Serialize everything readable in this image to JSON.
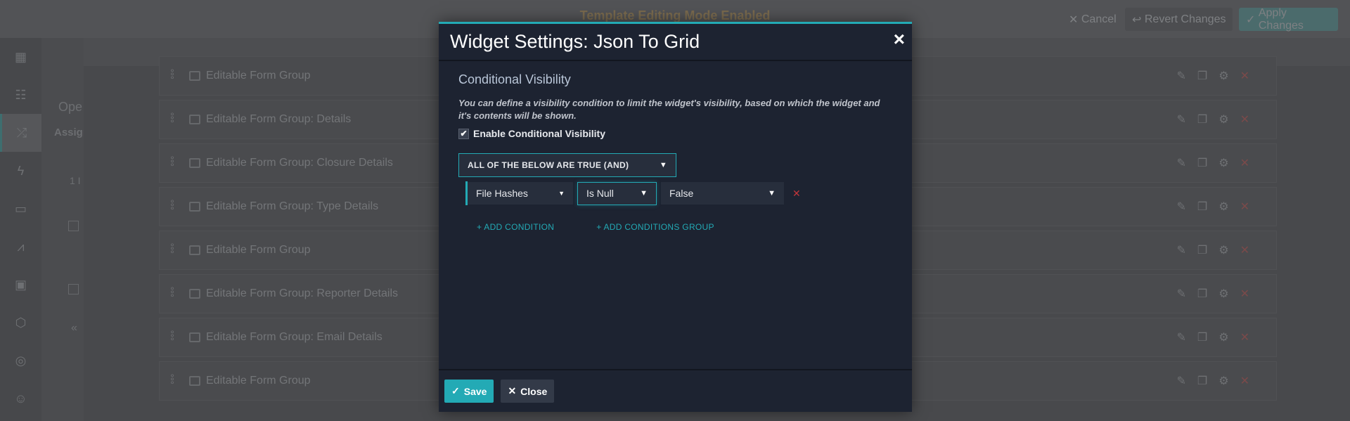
{
  "topbar": {
    "mode_text": "Template Editing Mode Enabled",
    "cancel": "Cancel",
    "revert": "Revert Changes",
    "apply": "Apply Changes"
  },
  "panel": {
    "title_partial": "Ope",
    "subtitle_partial": "Assign",
    "count_partial": "1 I"
  },
  "rows": [
    {
      "label": "Editable Form Group"
    },
    {
      "label": "Editable Form Group: Details"
    },
    {
      "label": "Editable Form Group: Closure Details"
    },
    {
      "label": "Editable Form Group: Type Details"
    },
    {
      "label": "Editable Form Group"
    },
    {
      "label": "Editable Form Group: Reporter Details"
    },
    {
      "label": "Editable Form Group: Email Details"
    },
    {
      "label": "Editable Form Group"
    }
  ],
  "modal": {
    "title": "Widget Settings: Json To Grid",
    "close_icon": "×",
    "section": "Conditional Visibility",
    "description": "You can define a visibility condition to limit the widget's visibility, based on which the widget and it's contents will be shown.",
    "enable_label": "Enable Conditional Visibility",
    "enable_checked": true,
    "group_operator": "ALL OF THE BELOW ARE TRUE (AND)",
    "condition": {
      "field": "File Hashes",
      "operator": "Is Null",
      "value": "False"
    },
    "add_condition": "+ ADD CONDITION",
    "add_group": "+ ADD CONDITIONS GROUP",
    "save": "Save",
    "close": "Close"
  },
  "colors": {
    "accent": "#23aab5",
    "modal_bg": "#1d2331",
    "delete": "#c0353a"
  }
}
